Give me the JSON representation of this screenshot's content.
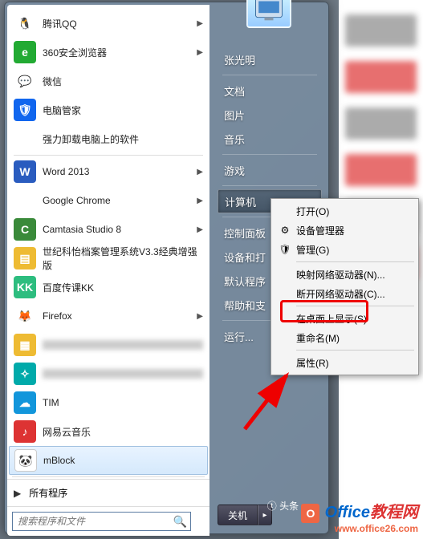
{
  "user_name": "张光明",
  "programs": [
    {
      "label": "腾讯QQ",
      "icon": "qq",
      "has_sub": true
    },
    {
      "label": "360安全浏览器",
      "icon": "360",
      "has_sub": true
    },
    {
      "label": "微信",
      "icon": "wx",
      "has_sub": false
    },
    {
      "label": "电脑管家",
      "icon": "gj",
      "has_sub": false
    },
    {
      "label": "强力卸载电脑上的软件",
      "icon": "un",
      "has_sub": false
    },
    {
      "label": "Word 2013",
      "icon": "wd",
      "has_sub": true
    },
    {
      "label": "Google Chrome",
      "icon": "ch",
      "has_sub": true
    },
    {
      "label": "Camtasia Studio 8",
      "icon": "cs",
      "has_sub": true
    },
    {
      "label": "世纪科怡档案管理系统V3.3经典增强版",
      "icon": "sj",
      "has_sub": false
    },
    {
      "label": "百度传课KK",
      "icon": "kk",
      "has_sub": false
    },
    {
      "label": "Firefox",
      "icon": "ff",
      "has_sub": true
    },
    {
      "label": "",
      "icon": "x1",
      "has_sub": false,
      "blurred": true
    },
    {
      "label": "",
      "icon": "x2",
      "has_sub": false,
      "blurred": true
    },
    {
      "label": "TIM",
      "icon": "tim",
      "has_sub": false
    },
    {
      "label": "网易云音乐",
      "icon": "wy",
      "has_sub": false
    },
    {
      "label": "mBlock",
      "icon": "mb",
      "has_sub": false,
      "selected": true
    }
  ],
  "all_programs_label": "所有程序",
  "search_placeholder": "搜索程序和文件",
  "right_items": [
    {
      "label": "文档"
    },
    {
      "label": "图片"
    },
    {
      "label": "音乐"
    },
    {
      "label": "游戏"
    },
    {
      "label": "计算机",
      "hover": true
    },
    {
      "label": "控制面板"
    },
    {
      "label": "设备和打印机",
      "clipped": "设备和打"
    },
    {
      "label": "默认程序"
    },
    {
      "label": "帮助和支持",
      "clipped": "帮助和支"
    },
    {
      "label": "运行..."
    }
  ],
  "shutdown_label": "关机",
  "context_menu": [
    {
      "label": "打开(O)"
    },
    {
      "label": "设备管理器",
      "icon": "gear"
    },
    {
      "label": "管理(G)",
      "icon": "shield"
    },
    {
      "sep": true
    },
    {
      "label": "映射网络驱动器(N)..."
    },
    {
      "label": "断开网络驱动器(C)..."
    },
    {
      "sep": true
    },
    {
      "label": "在桌面上显示(S)",
      "highlight": true
    },
    {
      "label": "重命名(M)"
    },
    {
      "sep": true
    },
    {
      "label": "属性(R)"
    }
  ],
  "watermark": {
    "brand": "Office",
    "suffix": "教程网",
    "url": "www.office26.com",
    "tt": "头条"
  }
}
